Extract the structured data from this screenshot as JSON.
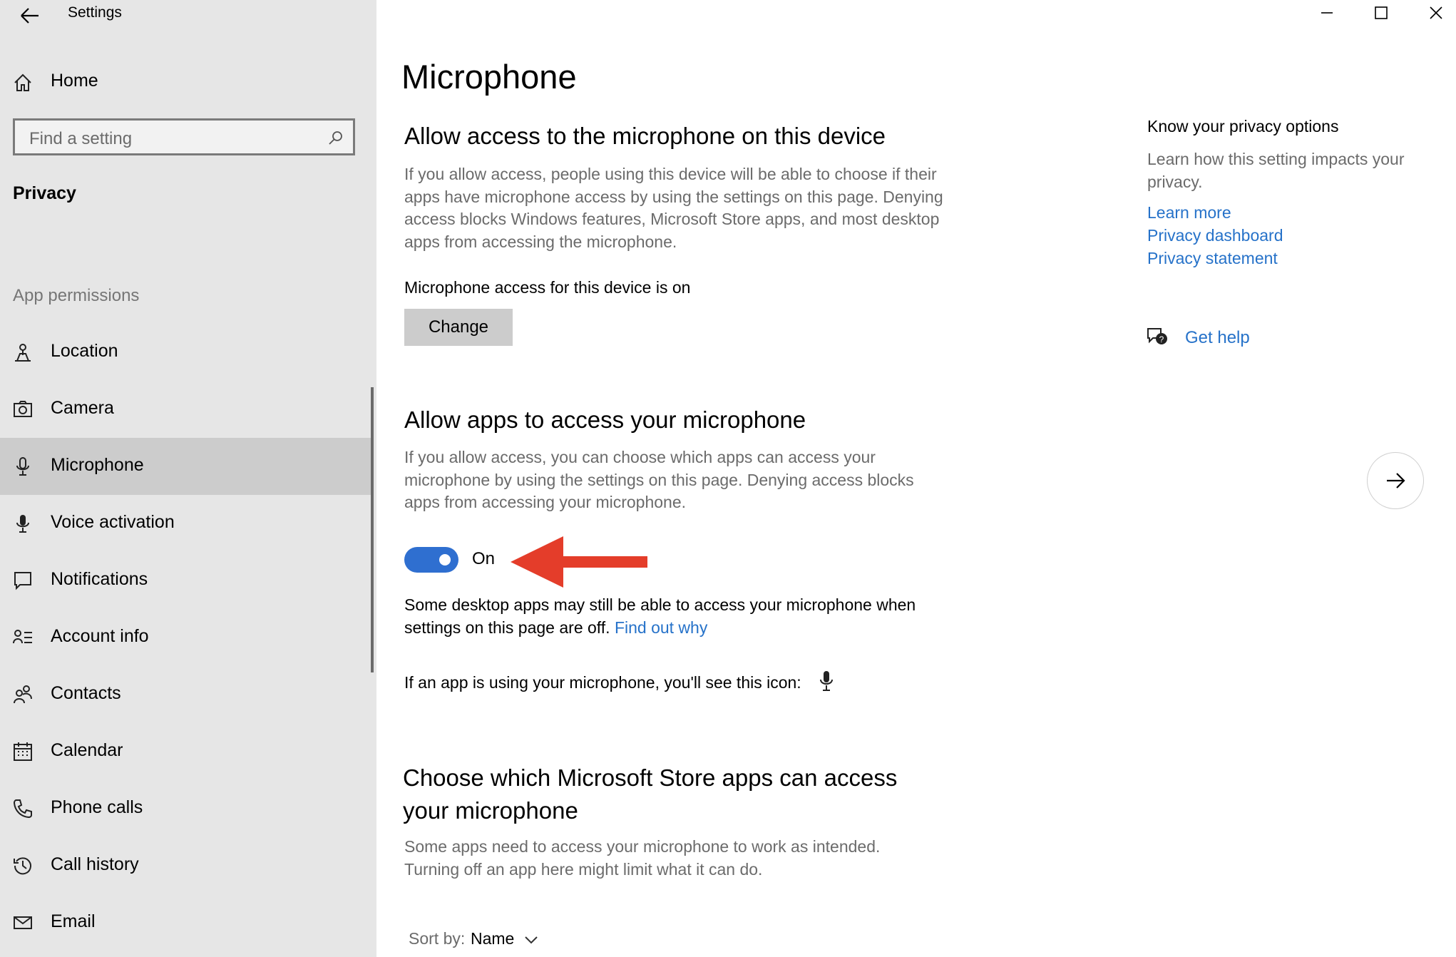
{
  "window": {
    "title": "Settings"
  },
  "sidebar": {
    "home_label": "Home",
    "search_placeholder": "Find a setting",
    "section": "Privacy",
    "group_label": "App permissions",
    "items": [
      {
        "label": "Location",
        "icon": "location-icon"
      },
      {
        "label": "Camera",
        "icon": "camera-icon"
      },
      {
        "label": "Microphone",
        "icon": "microphone-icon",
        "selected": true
      },
      {
        "label": "Voice activation",
        "icon": "voice-activation-icon"
      },
      {
        "label": "Notifications",
        "icon": "notifications-icon"
      },
      {
        "label": "Account info",
        "icon": "account-info-icon"
      },
      {
        "label": "Contacts",
        "icon": "contacts-icon"
      },
      {
        "label": "Calendar",
        "icon": "calendar-icon"
      },
      {
        "label": "Phone calls",
        "icon": "phone-icon"
      },
      {
        "label": "Call history",
        "icon": "history-icon"
      },
      {
        "label": "Email",
        "icon": "email-icon"
      }
    ]
  },
  "main": {
    "title": "Microphone",
    "device": {
      "heading": "Allow access to the microphone on this device",
      "description": "If you allow access, people using this device will be able to choose if their apps have microphone access by using the settings on this page. Denying access blocks Windows features, Microsoft Store apps, and most desktop apps from accessing the microphone.",
      "status": "Microphone access for this device is on",
      "change_button": "Change"
    },
    "apps": {
      "heading": "Allow apps to access your microphone",
      "description": "If you allow access, you can choose which apps can access your microphone by using the settings on this page. Denying access blocks apps from accessing your microphone.",
      "toggle_state": "On",
      "toggle_on": true,
      "note": "Some desktop apps may still be able to access your microphone when settings on this page are off.",
      "note_link": "Find out why",
      "icon_note": "If an app is using your microphone, you'll see this icon:"
    },
    "store": {
      "heading_line1": "Choose which Microsoft Store apps can access",
      "heading_line2": "your microphone",
      "description": "Some apps need to access your microphone to work as intended. Turning off an app here might limit what it can do.",
      "sort_label": "Sort by:",
      "sort_value": "Name"
    }
  },
  "right_panel": {
    "title": "Know your privacy options",
    "description": "Learn how this setting impacts your privacy.",
    "links": [
      "Learn more",
      "Privacy dashboard",
      "Privacy statement"
    ],
    "get_help": "Get help"
  },
  "colors": {
    "accent": "#2f6fd0",
    "link": "#2672c9",
    "sidebar_bg": "#e6e6e6",
    "selected_bg": "#cccccc",
    "annotation_arrow": "#e43d2a"
  }
}
